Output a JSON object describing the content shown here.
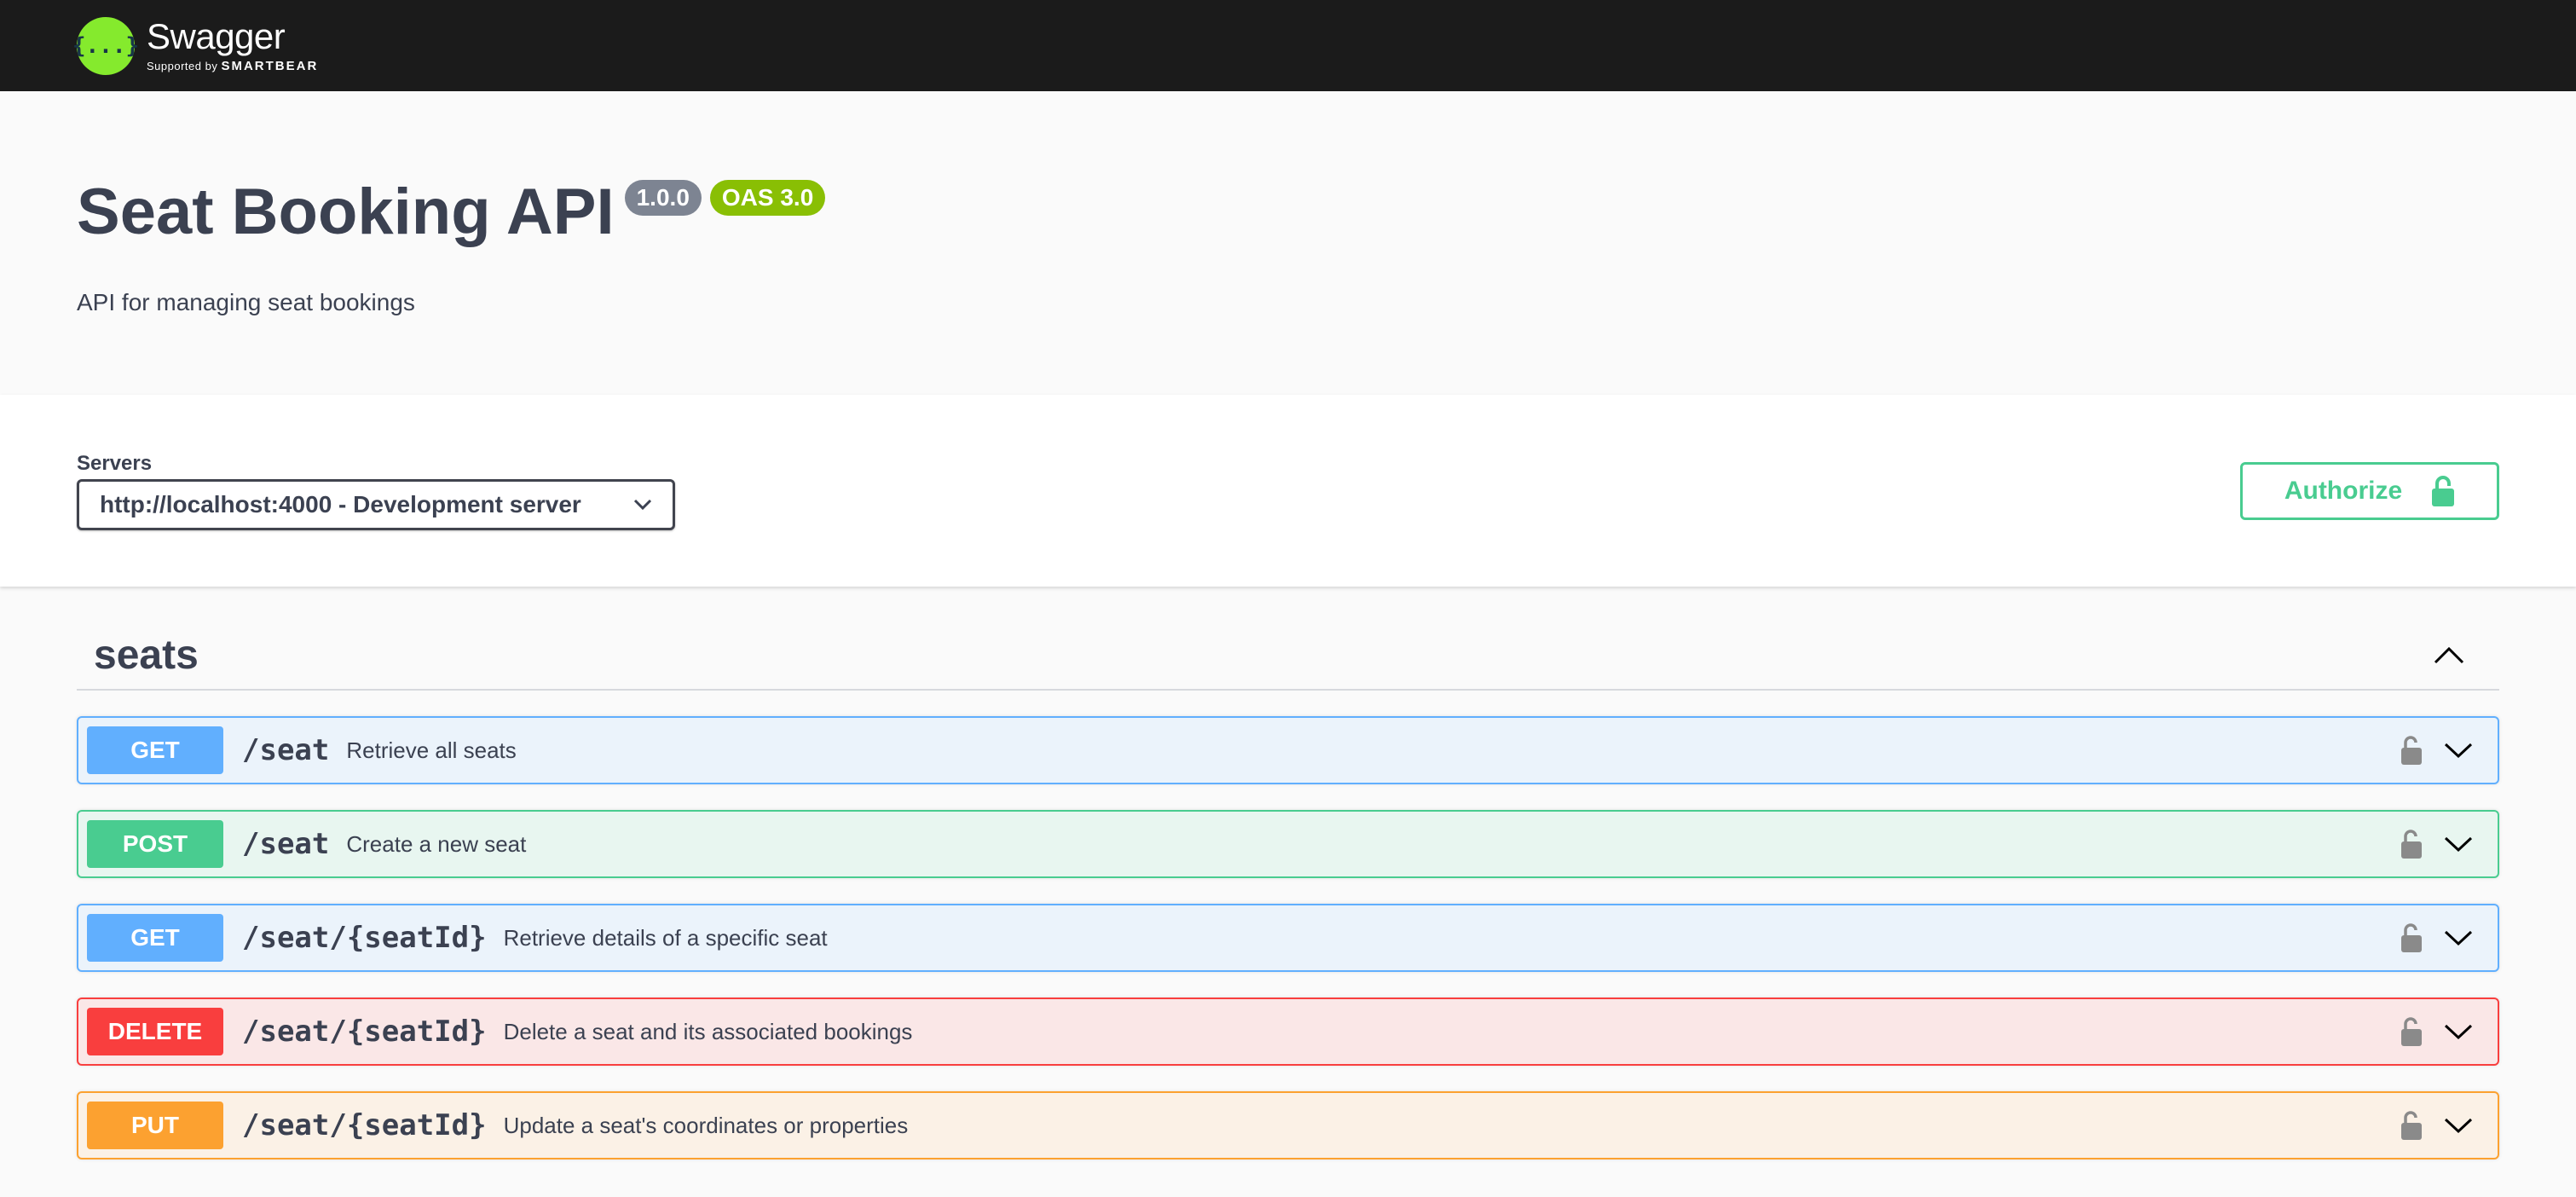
{
  "topbar": {
    "logo_name": "Swagger",
    "logo_sub_prefix": "Supported by",
    "logo_sub_brand": "SMARTBEAR",
    "logo_glyph": "{...}"
  },
  "info": {
    "title": "Seat Booking API",
    "version": "1.0.0",
    "oas": "OAS 3.0",
    "description": "API for managing seat bookings"
  },
  "scheme": {
    "servers_label": "Servers",
    "selected_server": "http://localhost:4000 - Development server",
    "authorize_label": "Authorize"
  },
  "tag": {
    "name": "seats",
    "expanded": true
  },
  "operations": [
    {
      "method": "GET",
      "path": "/seat",
      "summary": "Retrieve all seats"
    },
    {
      "method": "POST",
      "path": "/seat",
      "summary": "Create a new seat"
    },
    {
      "method": "GET",
      "path": "/seat/{seatId}",
      "summary": "Retrieve details of a specific seat"
    },
    {
      "method": "DELETE",
      "path": "/seat/{seatId}",
      "summary": "Delete a seat and its associated bookings"
    },
    {
      "method": "PUT",
      "path": "/seat/{seatId}",
      "summary": "Update a seat's coordinates or properties"
    }
  ],
  "colors": {
    "topbar": "#1b1b1b",
    "get": "#61affe",
    "post": "#49cc90",
    "delete": "#f93e3e",
    "put": "#fca130",
    "version_badge": "#7d8492",
    "oas_badge": "#89bf04"
  },
  "icons": {
    "logo": "swagger-logo-icon",
    "select_caret": "chevron-down-icon",
    "authorize": "lock-icon",
    "tag_toggle": "chevron-up-icon",
    "op_lock": "unlocked-icon",
    "op_expand": "chevron-down-icon"
  }
}
